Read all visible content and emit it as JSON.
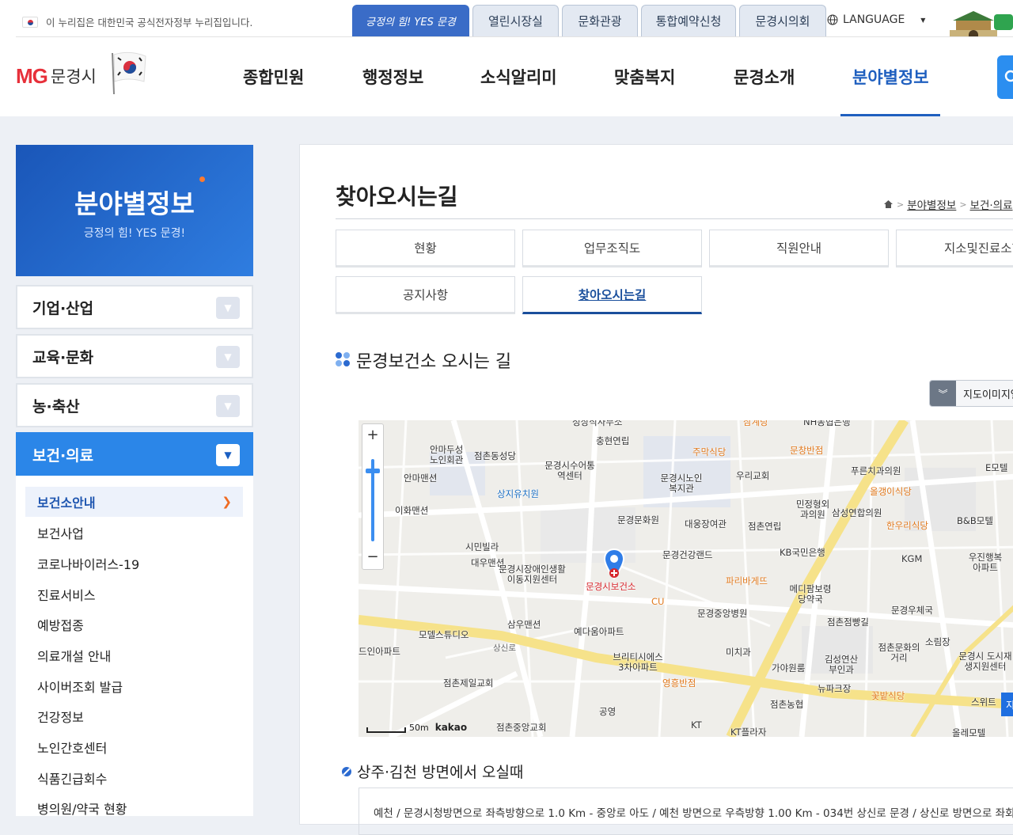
{
  "top_bar": {
    "nuri_text": "이 누리집은 대한민국 공식전자정부 누리집입니다.",
    "site_tabs": [
      "긍정의 힘! YES 문경",
      "열린시장실",
      "문화관광",
      "통합예약신청",
      "문경시의회"
    ],
    "language_label": "LANGUAGE"
  },
  "header": {
    "logo_mg": "MG",
    "logo_city": "문경시",
    "nav": [
      "종합민원",
      "행정정보",
      "소식알리미",
      "맞춤복지",
      "문경소개",
      "분야별정보"
    ],
    "active_nav": "분야별정보"
  },
  "sidebar": {
    "banner_title": "분야별정보",
    "banner_sub": "긍정의 힘! YES 문경!",
    "categories": [
      "기업·산업",
      "교육·문화",
      "농·축산",
      "보건·의료"
    ],
    "open_category": "보건·의료",
    "sub_items": [
      "보건소안내",
      "보건사업",
      "코로나바이러스-19",
      "진료서비스",
      "예방접종",
      "의료개설 안내",
      "사이버조회 발급",
      "건강정보",
      "노인간호센터",
      "식품긴급회수",
      "병의원/약국 현황"
    ],
    "active_sub": "보건소안내"
  },
  "content": {
    "page_title": "찾아오시는길",
    "breadcrumb": [
      "분야별정보",
      "보건·의료"
    ],
    "tabs": [
      "현황",
      "업무조직도",
      "직원안내",
      "지소및진료소현황",
      "공지사항",
      "찾아오시는길"
    ],
    "active_tab": "찾아오시는길",
    "section_title": "문경보건소 오시는 길",
    "map_toggle_label": "지도이미지열기",
    "map": {
      "labels": [
        "성상식사무소",
        "충현연립",
        "주막식당",
        "삼계탕",
        "NH농협은행",
        "문창반점",
        "안마두성노인회관",
        "점촌동성당",
        "문경시수어통역센터",
        "문경시노인복지관",
        "우리교회",
        "푸른치과의원",
        "E모텔",
        "안마맨션",
        "상지유치원",
        "올갱이식당",
        "이화맨션",
        "민정형외과의원",
        "삼성연합의원",
        "B&B모텔",
        "문경문화원",
        "대웅장여관",
        "점촌연립",
        "한우리식당",
        "시민빌라",
        "우진행복아파트",
        "대우맨션",
        "문경건강랜드",
        "KB국민은행",
        "KGM",
        "문경시장애인생활이동지원센터",
        "문경시보건소",
        "파리바게뜨",
        "메디팜보령당약국",
        "CU",
        "문경중앙병원",
        "문경우체국",
        "삼우맨션",
        "점촌점빵길",
        "소림장",
        "모델스튜디오",
        "예다움아파트",
        "미치과",
        "점촌문화의거리",
        "문경시 도시재생지원센터",
        "상신로",
        "브리티시에스3차아파트",
        "김성연산부인과",
        "가야원룸",
        "뉴파크장",
        "점촌제일교회",
        "영흥반점",
        "꽃밭식당",
        "스위트",
        "공영",
        "점촌농협",
        "점촌중앙교회",
        "KT",
        "KT플라자",
        "올레모텔",
        "드인아파트",
        "kakao",
        "50m",
        "지도"
      ]
    },
    "route_title": "상주·김천 방면에서 오실때",
    "route_text": "예천 / 문경시청방면으로 좌측방향으로 1.0 Km - 중앙로 아도 / 예천 방면으로 우측방향 1.00 Km - 034번 상신로 문경 / 상신로 방면으로 좌회전"
  },
  "colors": {
    "brand_blue": "#1f5fbf",
    "sidebar_open": "#2b86e8",
    "logo_red": "#e7303a",
    "accent_orange": "#ef6b22"
  }
}
